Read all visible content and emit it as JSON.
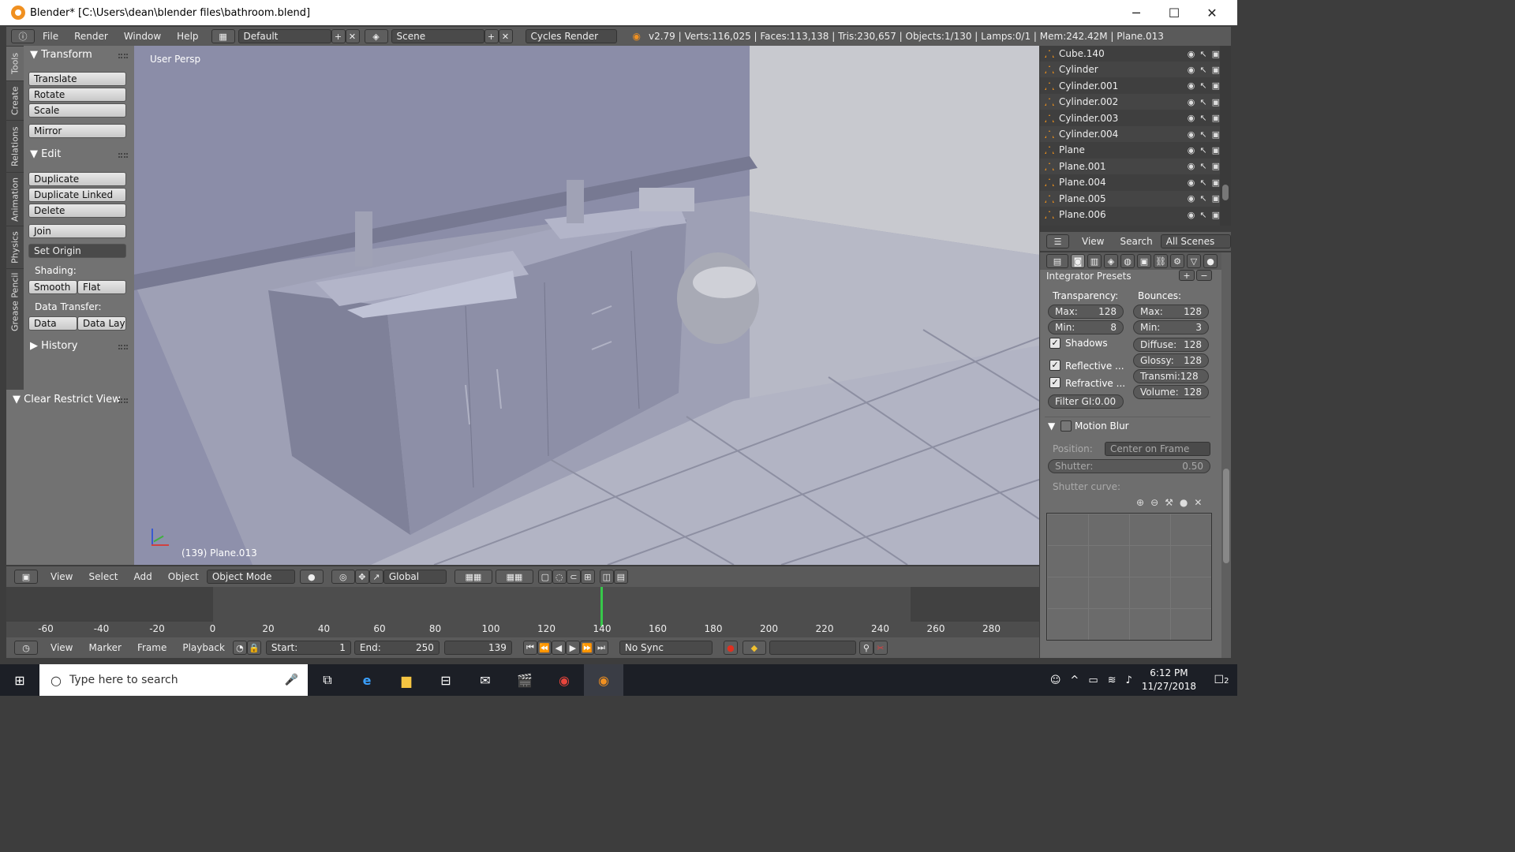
{
  "window": {
    "title": "Blender* [C:\\Users\\dean\\blender files\\bathroom.blend]",
    "minimize": "─",
    "maximize": "☐",
    "close": "✕"
  },
  "info_header": {
    "menus": [
      "File",
      "Render",
      "Window",
      "Help"
    ],
    "layout": "Default",
    "scene": "Scene",
    "engine": "Cycles Render",
    "stats": "v2.79 | Verts:116,025 | Faces:113,138 | Tris:230,657 | Objects:1/130 | Lamps:0/1 | Mem:242.42M | Plane.013"
  },
  "tool_tabs": [
    "Tools",
    "Create",
    "Relations",
    "Animation",
    "Physics",
    "Grease Pencil"
  ],
  "tool_shelf": {
    "transform": {
      "title": "Transform",
      "buttons": [
        "Translate",
        "Rotate",
        "Scale",
        "Mirror"
      ]
    },
    "edit": {
      "title": "Edit",
      "buttons": [
        "Duplicate",
        "Duplicate Linked",
        "Delete",
        "Join",
        "Set Origin"
      ],
      "shading_label": "Shading:",
      "smooth": "Smooth",
      "flat": "Flat",
      "data_transfer_label": "Data Transfer:",
      "data": "Data",
      "data_lay": "Data Lay"
    },
    "history": "History",
    "clear_restrict": "Clear Restrict View"
  },
  "viewport": {
    "label": "User Persp",
    "selection": "(139) Plane.013"
  },
  "view3d_header": {
    "menus": [
      "View",
      "Select",
      "Add",
      "Object"
    ],
    "mode": "Object Mode",
    "orientation": "Global"
  },
  "timeline": {
    "ticks": [
      "-60",
      "-40",
      "-20",
      "0",
      "20",
      "40",
      "60",
      "80",
      "100",
      "120",
      "140",
      "160",
      "180",
      "200",
      "220",
      "240",
      "260",
      "280"
    ],
    "current_frame": 139,
    "menus": [
      "View",
      "Marker",
      "Frame",
      "Playback"
    ],
    "start_label": "Start:",
    "start": "1",
    "end_label": "End:",
    "end": "250",
    "frame": "139",
    "sync": "No Sync"
  },
  "outliner": {
    "items": [
      "Cube.140",
      "Cylinder",
      "Cylinder.001",
      "Cylinder.002",
      "Cylinder.003",
      "Cylinder.004",
      "Plane",
      "Plane.001",
      "Plane.004",
      "Plane.005",
      "Plane.006"
    ],
    "view": "View",
    "search": "Search",
    "filter": "All Scenes"
  },
  "properties": {
    "presets": "Integrator Presets",
    "transparency_label": "Transparency:",
    "bounces_label": "Bounces:",
    "t_max": "Max:",
    "t_max_val": "128",
    "t_min": "Min:",
    "t_min_val": "8",
    "b_max": "Max:",
    "b_max_val": "128",
    "b_min": "Min:",
    "b_min_val": "3",
    "shadows": "Shadows",
    "diffuse": "Diffuse:",
    "diffuse_val": "128",
    "glossy": "Glossy:",
    "glossy_val": "128",
    "reflective": "Reflective ...",
    "transmi": "Transmi:128",
    "refractive": "Refractive ...",
    "volume": "Volume:",
    "volume_val": "128",
    "filter_gi": "Filter GI:0.00",
    "motion_blur": "Motion Blur",
    "position_label": "Position:",
    "position": "Center on Frame",
    "shutter": "Shutter:",
    "shutter_val": "0.50",
    "shutter_curve": "Shutter curve:"
  },
  "taskbar": {
    "search": "Type here to search",
    "time": "6:12 PM",
    "date": "11/27/2018",
    "notif": "2"
  }
}
